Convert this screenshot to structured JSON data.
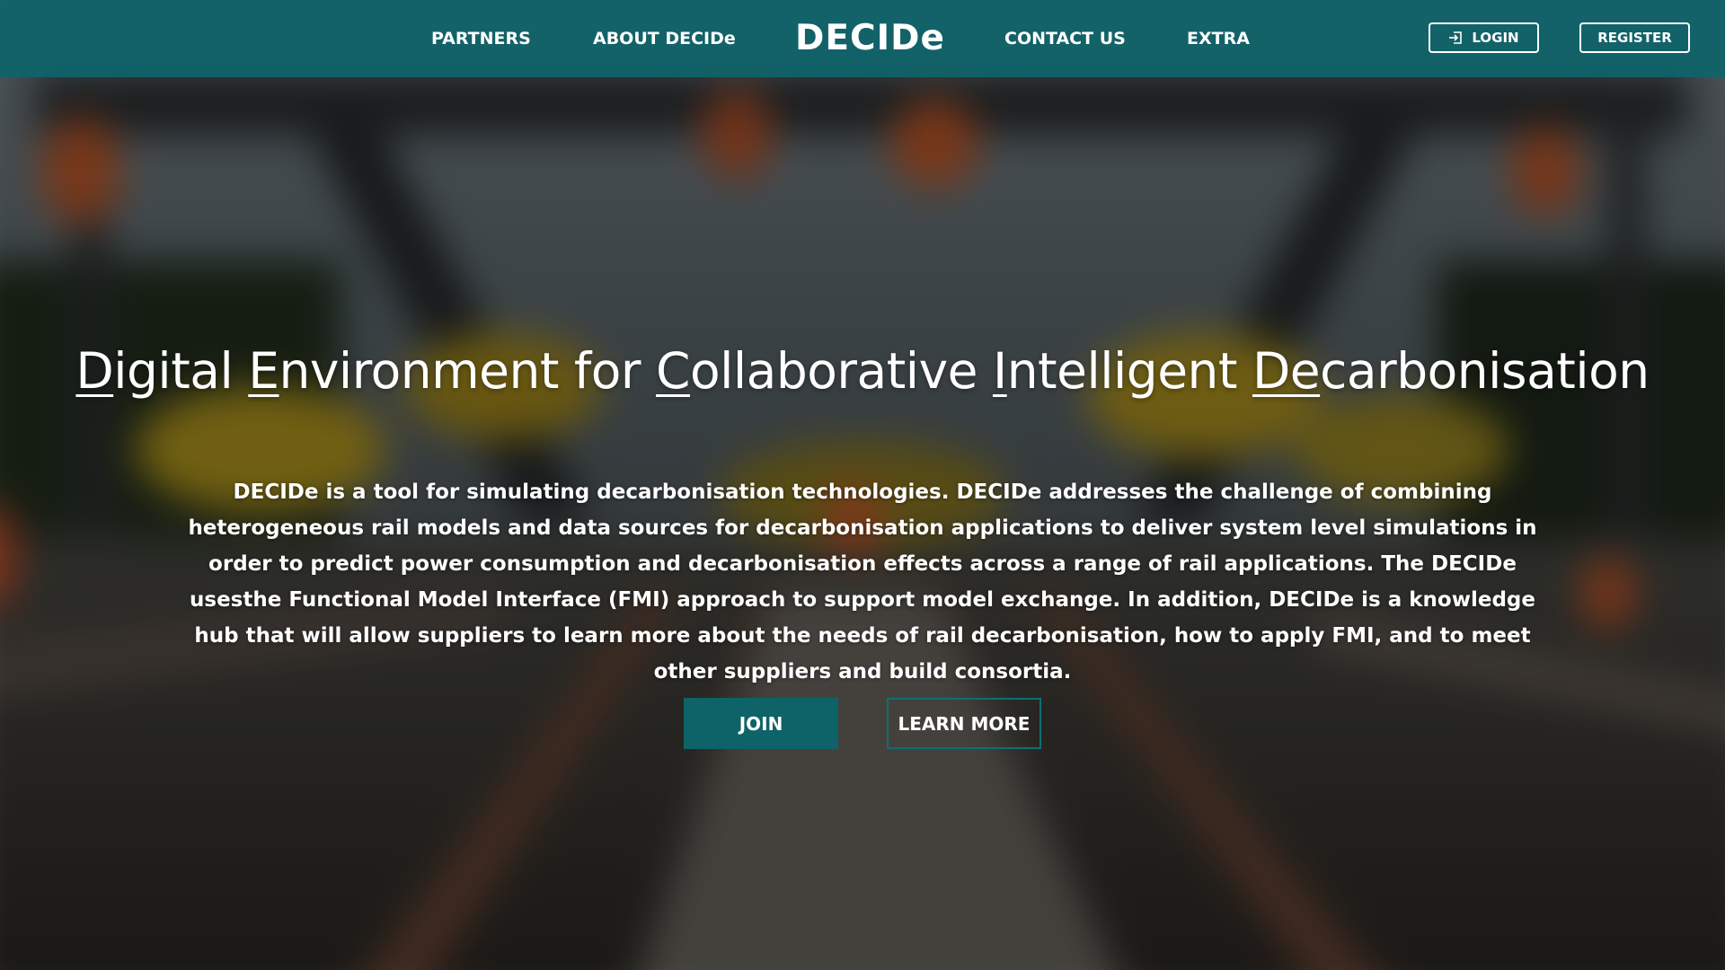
{
  "nav": {
    "partners": "PARTNERS",
    "about": "ABOUT DECIDe",
    "brand": "DECIDe",
    "contact": "CONTACT US",
    "extra": "EXTRA",
    "login": "LOGIN",
    "register": "REGISTER",
    "login_icon": "login-icon",
    "bar_color": "#0e646a"
  },
  "hero": {
    "title_parts": [
      {
        "text": "D",
        "underline": true
      },
      {
        "text": "igital ",
        "underline": false
      },
      {
        "text": "E",
        "underline": true
      },
      {
        "text": "nvironment for ",
        "underline": false
      },
      {
        "text": "C",
        "underline": true
      },
      {
        "text": "ollaborative ",
        "underline": false
      },
      {
        "text": "I",
        "underline": true
      },
      {
        "text": "ntelligent ",
        "underline": false
      },
      {
        "text": "De",
        "underline": true
      },
      {
        "text": "carbonisation",
        "underline": false
      }
    ],
    "description": "DECIDe is a tool for simulating decarbonisation technologies. DECIDe addresses the challenge of combining heterogeneous rail models and data sources for decarbonisation applications to deliver system level simulations in order to predict power consumption and decarbonisation effects across a range of rail applications. The DECIDe usesthe Functional Model Interface (FMI) approach to support model exchange. In addition, DECIDe is a knowledge hub that will allow suppliers to learn more about the needs of rail decarbonisation, how to apply FMI, and to meet other suppliers and build consortia.",
    "join_label": "JOIN",
    "learn_more_label": "LEARN MORE",
    "accent_color": "#0e6368"
  }
}
